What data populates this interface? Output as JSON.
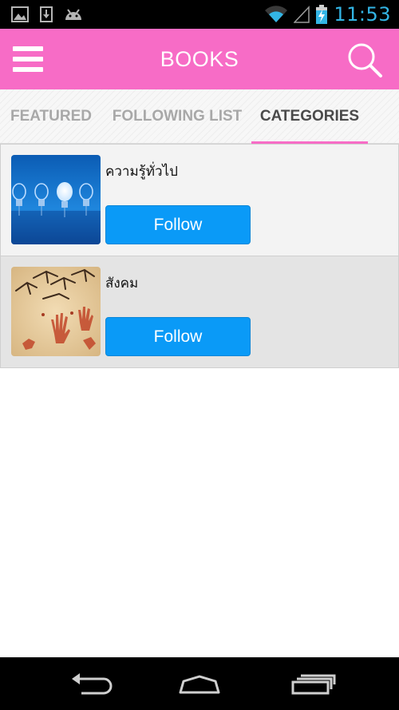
{
  "status_bar": {
    "time": "11:53",
    "left_icons": [
      "gallery-icon",
      "download-icon",
      "android-debug-icon"
    ],
    "right_icons": [
      "wifi-icon",
      "signal-icon",
      "battery-charging-icon"
    ],
    "time_color": "#33b5e5"
  },
  "action_bar": {
    "title": "BOOKS",
    "background_color": "#f76cc6",
    "menu_icon": "hamburger-menu-icon",
    "search_icon": "search-icon"
  },
  "tabs": [
    {
      "label": "FEATURED",
      "active": false
    },
    {
      "label": "FOLLOWING LIST",
      "active": false
    },
    {
      "label": "CATEGORIES",
      "active": true
    }
  ],
  "categories": [
    {
      "name": "ความรู้ทั่วไป",
      "thumbnail": "light-bulbs-image",
      "button_label": "Follow"
    },
    {
      "name": "สังคม",
      "thumbnail": "cave-painting-image",
      "button_label": "Follow"
    }
  ],
  "nav_bar": {
    "buttons": [
      "back-icon",
      "home-icon",
      "recent-apps-icon"
    ]
  },
  "colors": {
    "accent": "#f76cc6",
    "follow_button": "#0a9af7"
  }
}
